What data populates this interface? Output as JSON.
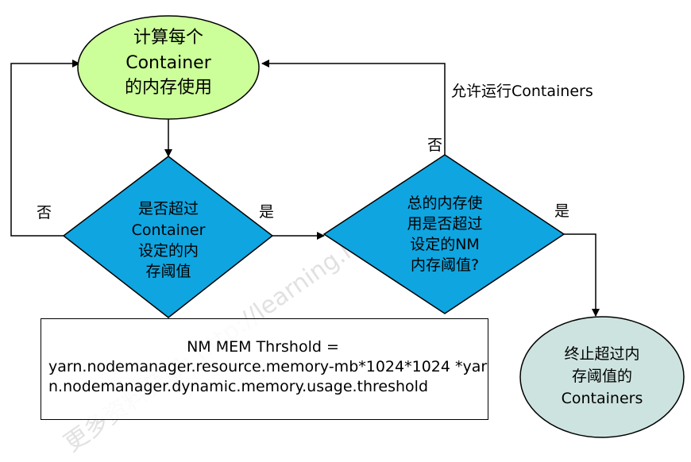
{
  "nodes": {
    "start": {
      "lines": [
        "计算每个",
        "Container",
        "的内存使用"
      ],
      "fill": "#ccff99"
    },
    "check_container": {
      "lines": [
        "是否超过",
        "Container",
        "设定的内",
        "存阈值"
      ],
      "fill": "#0fa5e0"
    },
    "check_total": {
      "lines": [
        "总的内存使",
        "用是否超过",
        "设定的NM",
        "内存阈值?"
      ],
      "fill": "#0fa5e0"
    },
    "terminate": {
      "lines": [
        "终止超过内",
        "存阈值的",
        "Containers"
      ],
      "fill": "#cde3df"
    }
  },
  "edge_labels": {
    "no_left": "否",
    "yes_middle": "是",
    "no_right": "否",
    "yes_right": "是",
    "allow": "允许运行Containers"
  },
  "note": {
    "title": "NM MEM Thrshold  =",
    "body": "yarn.nodemanager.resource.memory-mb*1024*1024 *yarn.nodemanager.dynamic.memory.usage.threshold"
  },
  "watermark": "更多资料获取: http://learning.huawei.com"
}
